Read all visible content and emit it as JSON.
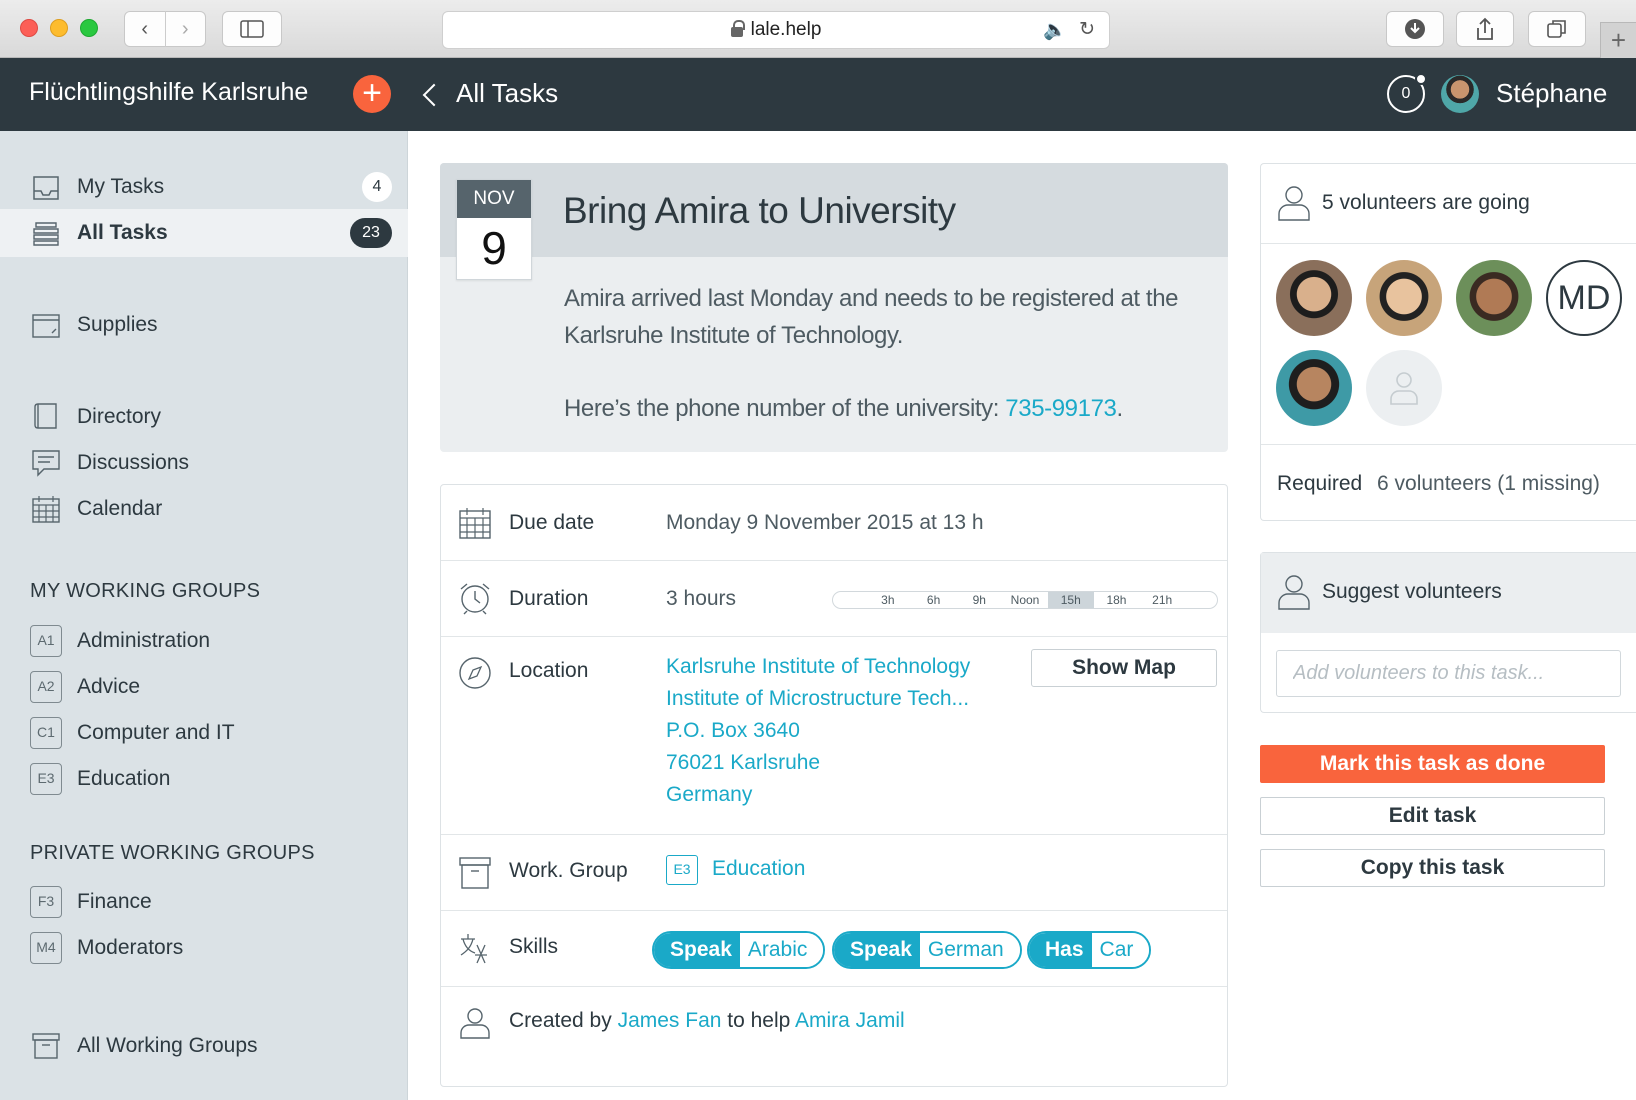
{
  "browser": {
    "url": "lale.help"
  },
  "header": {
    "org_name": "Flüchtlingshilfe Karlsruhe",
    "add_label": "+",
    "back_label": "All Tasks",
    "notification_count": "0",
    "username": "Stéphane"
  },
  "sidebar": {
    "items": [
      {
        "label": "My Tasks",
        "count": "4",
        "icon": "inbox-icon"
      },
      {
        "label": "All Tasks",
        "count": "23",
        "icon": "stack-icon",
        "active": true
      },
      {
        "label": "Supplies",
        "icon": "supplies-icon"
      },
      {
        "label": "Directory",
        "icon": "book-icon"
      },
      {
        "label": "Discussions",
        "icon": "chat-icon"
      },
      {
        "label": "Calendar",
        "icon": "calendar-icon"
      }
    ],
    "my_groups_heading": "MY WORKING GROUPS",
    "my_groups": [
      {
        "code": "A1",
        "label": "Administration"
      },
      {
        "code": "A2",
        "label": "Advice"
      },
      {
        "code": "C1",
        "label": "Computer and IT"
      },
      {
        "code": "E3",
        "label": "Education"
      }
    ],
    "private_groups_heading": "PRIVATE WORKING GROUPS",
    "private_groups": [
      {
        "code": "F3",
        "label": "Finance"
      },
      {
        "code": "M4",
        "label": "Moderators"
      }
    ],
    "all_groups_label": "All Working Groups"
  },
  "task": {
    "month": "NOV",
    "day": "9",
    "title": "Bring Amira to University",
    "description_1": "Amira arrived last Monday and needs to be registered at the Karlsruhe Institute of Technology.",
    "description_2_prefix": "Here’s the phone number of the university: ",
    "phone": "735-99173",
    "description_2_suffix": "."
  },
  "details": {
    "due_label": "Due date",
    "due_value": "Monday 9 November 2015 at 13 h",
    "duration_label": "Duration",
    "duration_value": "3 hours",
    "timeline_ticks": [
      "3h",
      "6h",
      "9h",
      "Noon",
      "15h",
      "18h",
      "21h"
    ],
    "timeline_highlight": "15h",
    "location_label": "Location",
    "address_lines": [
      "Karlsruhe Institute of Technology",
      "Institute of Microstructure Tech...",
      "P.O. Box 3640",
      "76021 Karlsruhe",
      "Germany"
    ],
    "show_map_label": "Show Map",
    "group_label": "Work. Group",
    "group_code": "E3",
    "group_name": "Education",
    "skills_label": "Skills",
    "skills": [
      {
        "verb": "Speak",
        "object": "Arabic"
      },
      {
        "verb": "Speak",
        "object": "German"
      },
      {
        "verb": "Has",
        "object": "Car"
      }
    ],
    "created_prefix": "Created by ",
    "creator": "James Fan",
    "created_middle": " to help ",
    "beneficiary": "Amira Jamil"
  },
  "volunteers": {
    "going_text": "5 volunteers are going",
    "initials": "MD",
    "required_label": "Required",
    "required_value": "6 volunteers (1 missing)"
  },
  "suggest": {
    "heading": "Suggest volunteers",
    "placeholder": "Add volunteers to this task..."
  },
  "actions": {
    "done_label": "Mark this task as done",
    "edit_label": "Edit task",
    "copy_label": "Copy this task"
  },
  "colors": {
    "accent": "#f9643d",
    "link": "#1aa9c8",
    "header_bg": "#2d3940",
    "sidebar_bg": "#dbe2e6"
  }
}
